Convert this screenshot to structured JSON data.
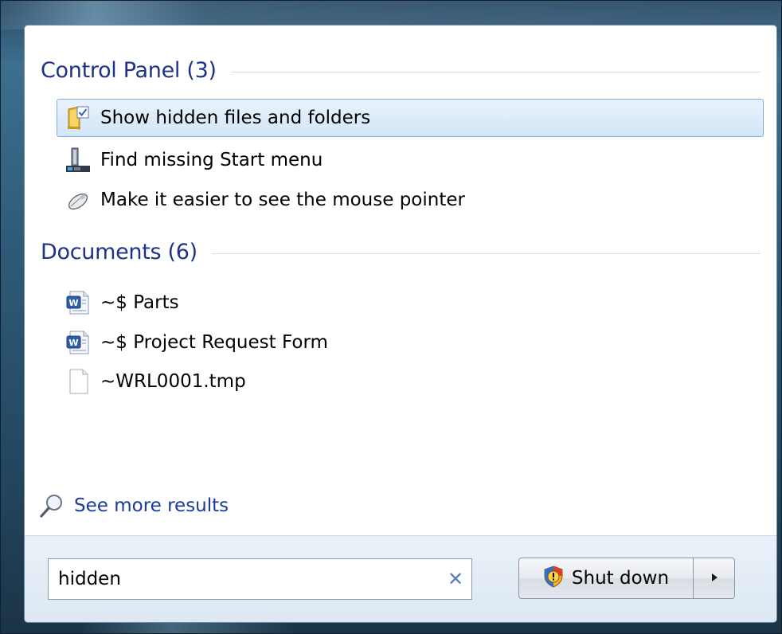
{
  "results": {
    "groups": [
      {
        "title": "Control Panel (3)",
        "items": [
          {
            "label": "Show hidden files and folders",
            "icon": "folder-options-icon",
            "selected": true
          },
          {
            "label": "Find missing Start menu",
            "icon": "taskbar-icon",
            "selected": false
          },
          {
            "label": "Make it easier to see the mouse pointer",
            "icon": "mouse-icon",
            "selected": false
          }
        ]
      },
      {
        "title": "Documents (6)",
        "items": [
          {
            "label": "~$ Parts",
            "icon": "word-document-icon",
            "selected": false
          },
          {
            "label": "~$ Project Request Form",
            "icon": "word-document-icon",
            "selected": false
          },
          {
            "label": "~WRL0001.tmp",
            "icon": "blank-file-icon",
            "selected": false
          }
        ]
      }
    ],
    "see_more": "See more results"
  },
  "search": {
    "value": "hidden",
    "clear_glyph": "✕"
  },
  "power": {
    "shutdown_label": "Shut down",
    "arrow_glyph": "▸"
  },
  "colors": {
    "group_title": "#1e3287",
    "link": "#1c3a9a",
    "selection_border": "#84acd8",
    "selection_fill": "#d3e6f8"
  }
}
